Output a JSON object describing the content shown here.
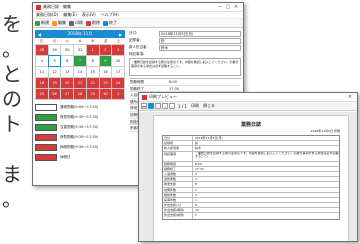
{
  "side_text": [
    "を",
    "。",
    "と",
    "の",
    "ト",
    "",
    "ま",
    "。"
  ],
  "win1": {
    "title": "業務日誌 - 編集",
    "menu": [
      "業務日誌(D)",
      "編集(E)",
      "表示(V)",
      "ヘルプ(H)"
    ],
    "toolbar": {
      "new": "新規",
      "edit": "編集",
      "print": "印刷",
      "delete": "削除",
      "done": "終了"
    },
    "calendar": {
      "prev": "◀",
      "month": "2018年 11月",
      "next": "▶",
      "days": [
        "日",
        "月",
        "火",
        "水",
        "木",
        "金",
        "土"
      ],
      "cells": [
        {
          "t": "28",
          "c": "red"
        },
        {
          "t": "29",
          "c": ""
        },
        {
          "t": "30",
          "c": ""
        },
        {
          "t": "31",
          "c": ""
        },
        {
          "t": "1",
          "c": "red"
        },
        {
          "t": "2",
          "c": "red"
        },
        {
          "t": "3",
          "c": "red"
        },
        {
          "t": "4",
          "c": ""
        },
        {
          "t": "5",
          "c": "sel"
        },
        {
          "t": "6",
          "c": ""
        },
        {
          "t": "7",
          "c": "green"
        },
        {
          "t": "8",
          "c": ""
        },
        {
          "t": "9",
          "c": "green"
        },
        {
          "t": "10",
          "c": ""
        },
        {
          "t": "11",
          "c": ""
        },
        {
          "t": "12",
          "c": ""
        },
        {
          "t": "13",
          "c": ""
        },
        {
          "t": "14",
          "c": ""
        },
        {
          "t": "15",
          "c": ""
        },
        {
          "t": "16",
          "c": ""
        },
        {
          "t": "17",
          "c": ""
        },
        {
          "t": "18",
          "c": "red"
        },
        {
          "t": "19",
          "c": "red"
        },
        {
          "t": "20",
          "c": "red"
        },
        {
          "t": "21",
          "c": "red"
        },
        {
          "t": "22",
          "c": "red"
        },
        {
          "t": "23",
          "c": "red"
        },
        {
          "t": "24",
          "c": "red"
        },
        {
          "t": "25",
          "c": "red"
        },
        {
          "t": "26",
          "c": "red"
        },
        {
          "t": "27",
          "c": "red"
        },
        {
          "t": "28",
          "c": "red"
        },
        {
          "t": "29",
          "c": "red"
        },
        {
          "t": "30",
          "c": "red"
        },
        {
          "t": "1",
          "c": "red"
        }
      ]
    },
    "legend": [
      {
        "label": "通常勤務(9:00〜17:30)",
        "color": "#ffffff"
      },
      {
        "label": "夜勤勤務(9:30〜17:30)",
        "color": "#2f9e44"
      },
      {
        "label": "当直勤務(9:30〜17:30)",
        "color": "#2f9e44"
      },
      {
        "label": "夜勤勤務(9:30〜17:30)",
        "color": "#d63b3b"
      },
      {
        "label": "休暇勤務(9:30〜17:30)",
        "color": "#d63b3b"
      },
      {
        "label": "休暇日",
        "color": "#d63b3b"
      }
    ],
    "form": {
      "date_label": "日付:",
      "date_value": "2018年11月5日(月)",
      "staff_label": "記録者:",
      "staff_value": "鈴",
      "title_label": "新人担当者:",
      "title_value": "鈴木",
      "memo_label": "特記事項:",
      "memo_value": "・業務日誌を記録する際の注意点です。内容を確認し記入してください。引継ぎ事項がある場合は必ず記載すること。"
    },
    "rows": [
      {
        "l": "勤務時間",
        "v": "8:00"
      },
      {
        "l": "勤務終了",
        "v": "17:30"
      },
      {
        "l": "入浴者数",
        "v": "4"
      },
      {
        "l": "退所者数",
        "v": "5"
      },
      {
        "l": "排泄支援",
        "v": "8"
      },
      {
        "l": "訪問件数",
        "v": "2"
      },
      {
        "l": "相談件数",
        "v": "3"
      },
      {
        "l": "来客件数",
        "v": "1"
      }
    ]
  },
  "win2": {
    "title": "印刷プレビュー",
    "toolbar": {
      "page": "1 / 1",
      "print": "印刷",
      "close": "閉じる"
    },
    "paper": {
      "title": "業務日誌",
      "date": "2018年11月5日 印刷",
      "rows": [
        {
          "l": "日付",
          "v": "2018年11月5日(月)",
          "tall": false
        },
        {
          "l": "記録者",
          "v": "鈴",
          "tall": false
        },
        {
          "l": "新人担当者",
          "v": "鈴木",
          "tall": false
        },
        {
          "l": "特記事項",
          "v": "・業務日誌を記録する際の注意点です。内容を確認し記入してください。引継ぎ事項がある場合は必ず記載すること。",
          "tall": true
        },
        {
          "l": "勤務時間",
          "v": "8:00",
          "tall": false
        },
        {
          "l": "勤務終了",
          "v": "17:30",
          "tall": false
        },
        {
          "l": "入浴者数",
          "v": "4",
          "tall": false
        },
        {
          "l": "退所者数",
          "v": "5",
          "tall": false
        },
        {
          "l": "排泄支援",
          "v": "8",
          "tall": false
        },
        {
          "l": "訪問件数",
          "v": "2",
          "tall": false
        },
        {
          "l": "相談件数",
          "v": "3",
          "tall": false
        },
        {
          "l": "来客件数",
          "v": "1",
          "tall": false
        },
        {
          "l": "外出支援(人)",
          "v": "6",
          "tall": false
        },
        {
          "l": "外出支援(時間)",
          "v": "14",
          "tall": false
        },
        {
          "l": "外出支援(場所)",
          "v": "1",
          "tall": false
        }
      ]
    }
  }
}
